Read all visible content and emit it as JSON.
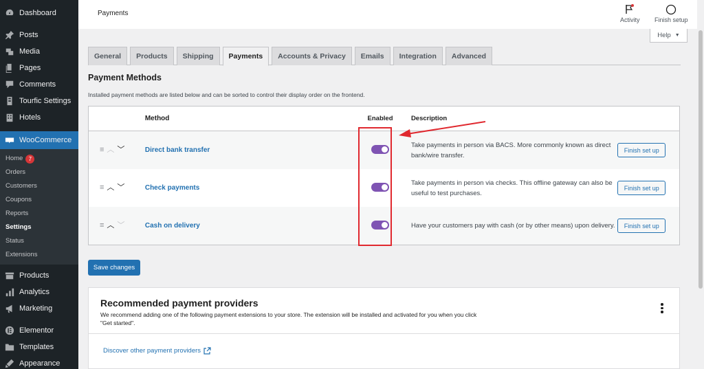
{
  "sidebar": {
    "items_top": [
      {
        "label": "Dashboard",
        "icon": "dashboard-icon"
      },
      {
        "label": "Posts",
        "icon": "pin-icon"
      },
      {
        "label": "Media",
        "icon": "media-icon"
      },
      {
        "label": "Pages",
        "icon": "pages-icon"
      },
      {
        "label": "Comments",
        "icon": "comments-icon"
      },
      {
        "label": "Tourfic Settings",
        "icon": "tourfic-icon"
      },
      {
        "label": "Hotels",
        "icon": "hotels-icon"
      }
    ],
    "woocommerce": {
      "label": "WooCommerce",
      "icon": "woo-icon"
    },
    "submenu": [
      "Home",
      "Orders",
      "Customers",
      "Coupons",
      "Reports",
      "Settings",
      "Status",
      "Extensions"
    ],
    "home_badge": "7",
    "items_bottom": [
      {
        "label": "Products",
        "icon": "products-icon"
      },
      {
        "label": "Analytics",
        "icon": "analytics-icon"
      },
      {
        "label": "Marketing",
        "icon": "marketing-icon"
      },
      {
        "label": "Elementor",
        "icon": "elementor-icon"
      },
      {
        "label": "Templates",
        "icon": "templates-icon"
      },
      {
        "label": "Appearance",
        "icon": "appearance-icon"
      }
    ]
  },
  "header": {
    "title": "Payments",
    "activity_label": "Activity",
    "finish_setup_label": "Finish setup",
    "help_label": "Help"
  },
  "tabs": [
    "General",
    "Products",
    "Shipping",
    "Payments",
    "Accounts & Privacy",
    "Emails",
    "Integration",
    "Advanced"
  ],
  "active_tab": "Payments",
  "payment_methods": {
    "heading": "Payment Methods",
    "description": "Installed payment methods are listed below and can be sorted to control their display order on the frontend.",
    "columns": {
      "method": "Method",
      "enabled": "Enabled",
      "description": "Description"
    },
    "rows": [
      {
        "name": "Direct bank transfer",
        "enabled": true,
        "description": "Take payments in person via BACS. More commonly known as direct bank/wire transfer.",
        "action": "Finish set up"
      },
      {
        "name": "Check payments",
        "enabled": true,
        "description": "Take payments in person via checks. This offline gateway can also be useful to test purchases.",
        "action": "Finish set up"
      },
      {
        "name": "Cash on delivery",
        "enabled": true,
        "description": "Have your customers pay with cash (or by other means) upon delivery.",
        "action": "Finish set up"
      }
    ]
  },
  "save_label": "Save changes",
  "recommended": {
    "title": "Recommended payment providers",
    "text": "We recommend adding one of the following payment extensions to your store. The extension will be installed and activated for you when you click \"Get started\".",
    "link": "Discover other payment providers"
  },
  "colors": {
    "accent": "#2271b1",
    "toggle_on": "#7f54b3",
    "annotation": "#e0282e",
    "sidebar_bg": "#1d2327"
  }
}
